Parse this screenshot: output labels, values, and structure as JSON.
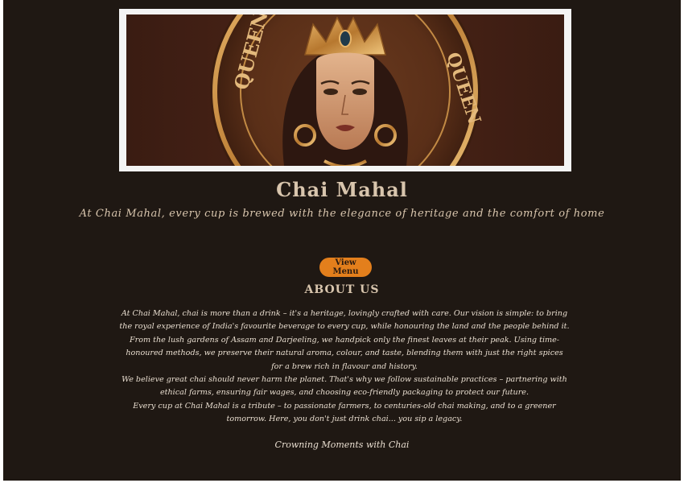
{
  "hero": {
    "image_description": "Illustrated coin with crowned woman portrait",
    "coin_text_left": "QUEEN",
    "coin_text_right": "QUEEN"
  },
  "brand": {
    "title": "Chai Mahal",
    "tagline": "At Chai Mahal, every cup is brewed with the elegance of heritage and the comfort of home"
  },
  "cta": {
    "menu_label": "View Menu"
  },
  "about": {
    "title": "ABOUT US",
    "paragraphs": [
      "At Chai Mahal, chai is more than a drink – it's a heritage, lovingly crafted with care. Our vision is simple: to bring the royal experience of India's favourite beverage to every cup, while honouring the land and the people behind it.",
      "From the lush gardens of Assam and Darjeeling, we handpick only the finest leaves at their peak. Using time-honoured methods, we preserve their natural aroma, colour, and taste, blending them with just the right spices for a brew rich in flavour and history.",
      "We believe great chai should never harm the planet. That's why we follow sustainable practices – partnering with ethical farms, ensuring fair wages, and choosing eco-friendly packaging to protect our future.",
      "Every cup at Chai Mahal is a tribute – to passionate farmers, to centuries-old chai making, and to a greener tomorrow. Here, you don't just drink chai... you sip a legacy."
    ]
  },
  "gallery": {
    "title": "Crowning Moments with Chai"
  },
  "colors": {
    "background": "#1f1813",
    "accent": "#e37f1c",
    "heading": "#d8c5ad",
    "body_text": "#e9ded0"
  }
}
